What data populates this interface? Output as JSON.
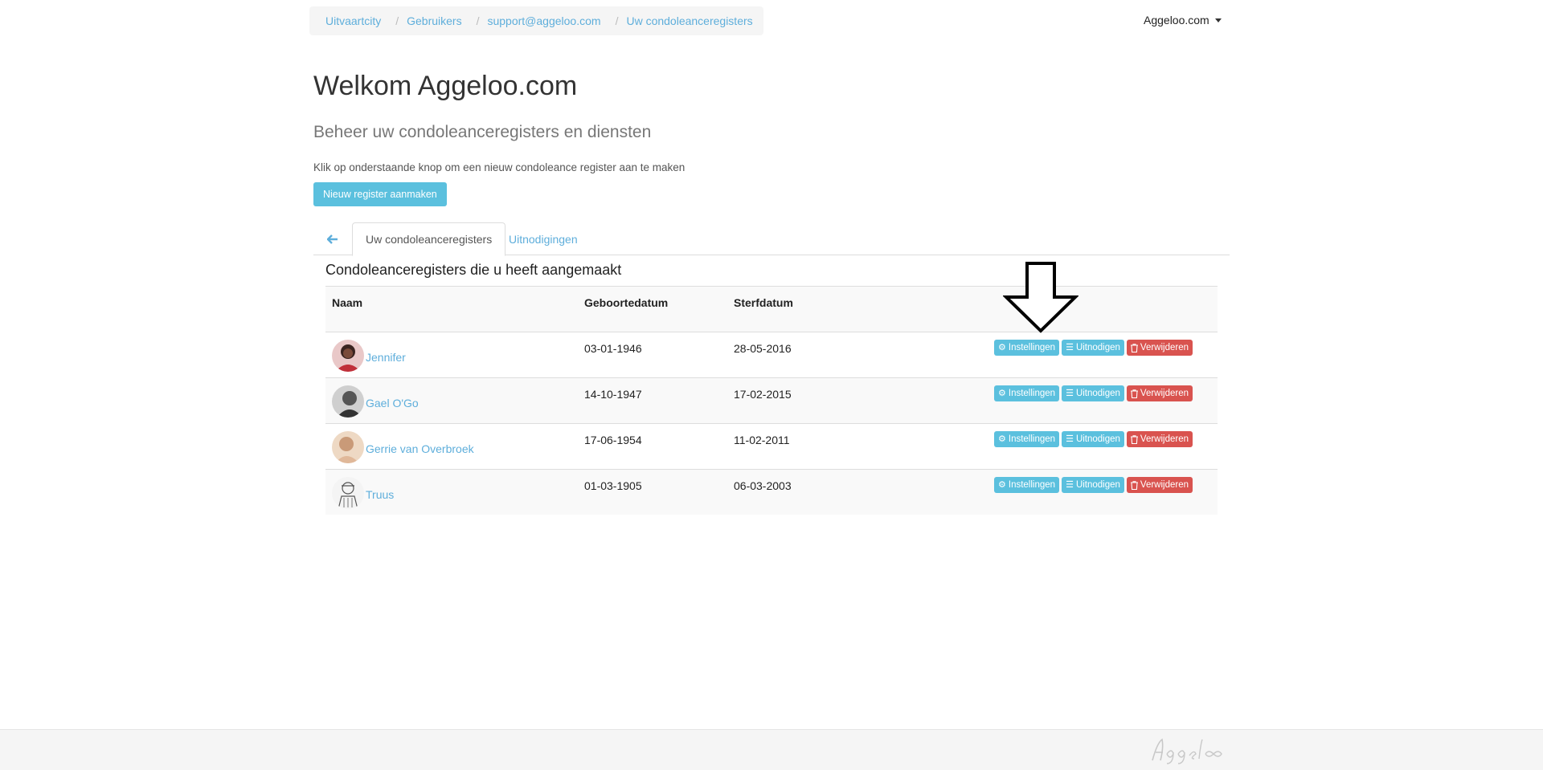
{
  "breadcrumb": [
    {
      "label": "Uitvaartcity"
    },
    {
      "label": "Gebruikers"
    },
    {
      "label": "support@aggeloo.com"
    },
    {
      "label": "Uw condoleanceregisters"
    }
  ],
  "breadcrumb_separator": "/",
  "account": {
    "label": "Aggeloo.com"
  },
  "page": {
    "title": "Welkom Aggeloo.com",
    "subtitle": "Beheer uw condoleanceregisters en diensten",
    "intro": "Klik op onderstaande knop om een nieuw condoleance register aan te maken",
    "new_button": "Nieuw register aanmaken"
  },
  "tabs": {
    "active": "Uw condoleanceregisters",
    "other": "Uitnodigingen"
  },
  "section": {
    "heading": "Condoleanceregisters die u heeft aangemaakt"
  },
  "table": {
    "columns": [
      "Naam",
      "Geboortedatum",
      "Sterfdatum"
    ],
    "rows": [
      {
        "name": "Jennifer",
        "birth": "03-01-1946",
        "death": "28-05-2016",
        "avatar": "avatar-woman-red"
      },
      {
        "name": "Gael O'Go",
        "birth": "14-10-1947",
        "death": "17-02-2015",
        "avatar": "avatar-man-grey"
      },
      {
        "name": "Gerrie van Overbroek",
        "birth": "17-06-1954",
        "death": "11-02-2011",
        "avatar": "avatar-woman-beige"
      },
      {
        "name": "Truus",
        "birth": "01-03-1905",
        "death": "06-03-2003",
        "avatar": "avatar-sketch"
      }
    ],
    "actions": {
      "settings": "Instellingen",
      "invite": "Uitnodigen",
      "delete": "Verwijderen"
    }
  },
  "colors": {
    "link": "#5eaedb",
    "info": "#5bc0de",
    "danger": "#d9534f"
  },
  "icons": {
    "back": "arrow-left-icon",
    "settings": "gear-icon",
    "invite": "list-icon",
    "delete": "trash-icon",
    "annotation": "down-arrow-annotation"
  }
}
